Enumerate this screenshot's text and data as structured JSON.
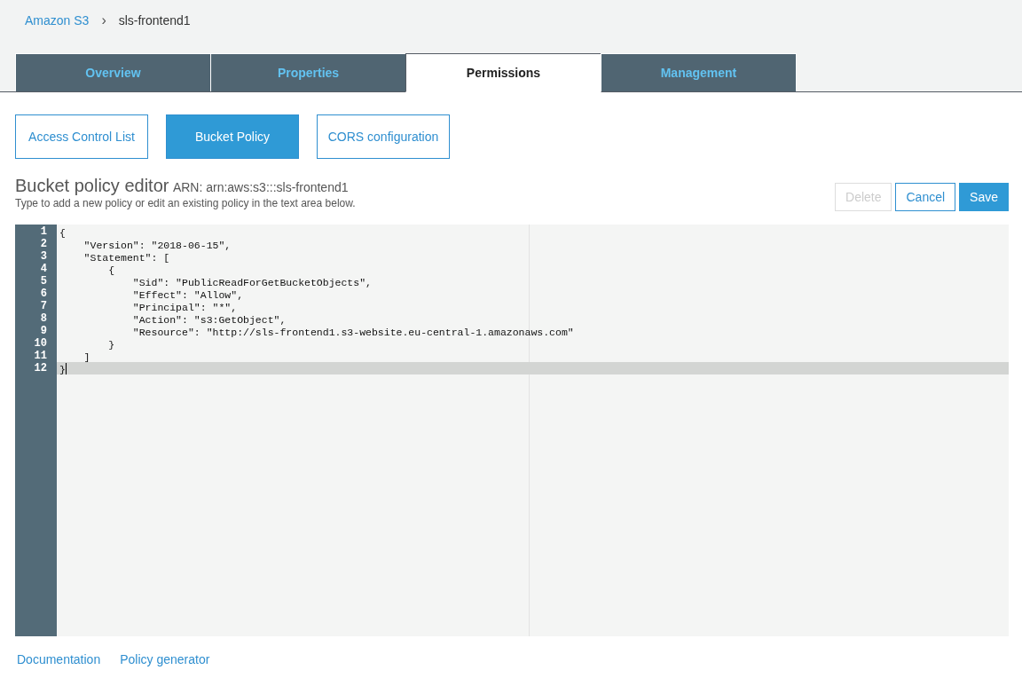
{
  "breadcrumb": {
    "root": "Amazon S3",
    "separator": "›",
    "current": "sls-frontend1"
  },
  "tabs": [
    {
      "label": "Overview",
      "selected": false
    },
    {
      "label": "Properties",
      "selected": false
    },
    {
      "label": "Permissions",
      "selected": true
    },
    {
      "label": "Management",
      "selected": false
    }
  ],
  "subtabs": [
    {
      "label": "Access Control List",
      "selected": false
    },
    {
      "label": "Bucket Policy",
      "selected": true
    },
    {
      "label": "CORS configuration",
      "selected": false
    }
  ],
  "editor_header": {
    "title": "Bucket policy editor",
    "arn": "ARN: arn:aws:s3:::sls-frontend1",
    "hint": "Type to add a new policy or edit an existing policy in the text area below."
  },
  "buttons": [
    {
      "label": "Delete",
      "kind": "default",
      "disabled": true
    },
    {
      "label": "Cancel",
      "kind": "default",
      "disabled": false
    },
    {
      "label": "Save",
      "kind": "primary",
      "disabled": false
    }
  ],
  "editor": {
    "lines": [
      {
        "number": "1",
        "text": "{",
        "active": false
      },
      {
        "number": "2",
        "text": "    \"Version\": \"2018-06-15\",",
        "active": false
      },
      {
        "number": "3",
        "text": "    \"Statement\": [",
        "active": false
      },
      {
        "number": "4",
        "text": "        {",
        "active": false
      },
      {
        "number": "5",
        "text": "            \"Sid\": \"PublicReadForGetBucketObjects\",",
        "active": false
      },
      {
        "number": "6",
        "text": "            \"Effect\": \"Allow\",",
        "active": false
      },
      {
        "number": "7",
        "text": "            \"Principal\": \"*\",",
        "active": false
      },
      {
        "number": "8",
        "text": "            \"Action\": \"s3:GetObject\",",
        "active": false
      },
      {
        "number": "9",
        "text": "            \"Resource\": \"http://sls-frontend1.s3-website.eu-central-1.amazonaws.com\"",
        "active": false
      },
      {
        "number": "10",
        "text": "        }",
        "active": false
      },
      {
        "number": "11",
        "text": "    ]",
        "active": false
      },
      {
        "number": "12",
        "text": "}",
        "active": true
      }
    ]
  },
  "footer_links": [
    "Documentation",
    "Policy generator"
  ]
}
